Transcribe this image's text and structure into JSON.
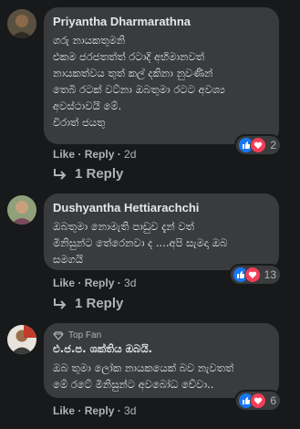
{
  "comments": [
    {
      "author": "Priyantha Dharmarathna",
      "lines": [
        "ගරු නායකතුමනි",
        "එකම ජරජතත්ත් රටාදි අභිමානවත්",
        "නායකත්වය තුත් කල් දකිනා නුවණින්",
        "තෙබි රටක් වට්නා ඔබතුමා රටට අවශ්‍ය",
        "අවස්ථාවයි මේ.",
        "විරාත් ජයතු"
      ],
      "like_label": "Like",
      "reply_label": "Reply",
      "time": "2d",
      "reaction_count": "2",
      "replies_label": "1 Reply"
    },
    {
      "author": "Dushyantha Hettiarachchi",
      "lines": [
        "ඔබතුමා නොමැති පාඩුව දැන් වත්",
        "මිනිසුන්ට තේරෙනවා ද ....අපි සැමදා ඔබ",
        "සමගයි"
      ],
      "like_label": "Like",
      "reply_label": "Reply",
      "time": "3d",
      "reaction_count": "13",
      "replies_label": "1 Reply"
    },
    {
      "badge": "Top Fan",
      "author": "එ.ජ.ප. ශක්තිය ඔබයි.",
      "lines": [
        "ඔබ තුමා ලෝක නායකයෙක් බව නැවතත්",
        "මේ රටේ මිනිසුන්ට අවබෝධ වේවා.."
      ],
      "like_label": "Like",
      "reply_label": "Reply",
      "time": "3d",
      "reaction_count": "6"
    }
  ],
  "colors": {
    "background": "#18191a",
    "bubble": "#3a3b3c",
    "text": "#e4e6eb",
    "muted": "#b0b3b8",
    "like": "#1877f2",
    "love": "#f33e58"
  },
  "icons": [
    "like-icon",
    "love-icon",
    "reply-arrow-icon",
    "top-fan-icon"
  ]
}
